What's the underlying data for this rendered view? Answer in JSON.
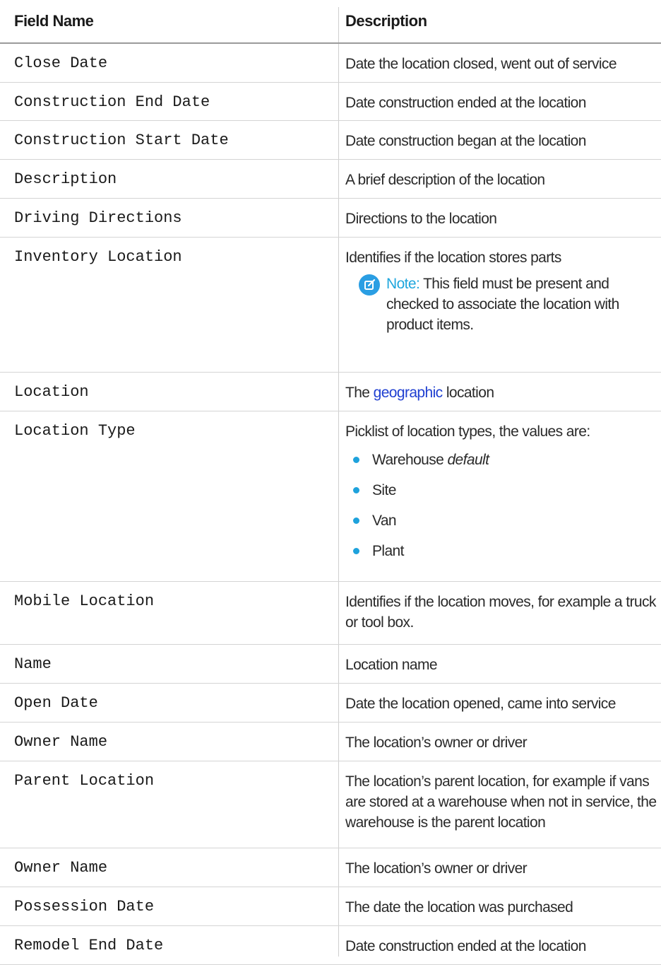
{
  "header": {
    "field_name": "Field Name",
    "description": "Description"
  },
  "rows": [
    {
      "field": "Close Date",
      "desc": "Date the location closed, went out of service"
    },
    {
      "field": "Construction End Date",
      "desc": "Date construction ended at the location"
    },
    {
      "field": "Construction Start Date",
      "desc": "Date construction began at the location"
    },
    {
      "field": "Description",
      "desc": "A brief description of the location"
    },
    {
      "field": "Driving Directions",
      "desc": "Directions to the location"
    },
    {
      "field": "Inventory Location",
      "desc": "Identifies if the location stores parts",
      "note_label": "Note:",
      "note_text": "This field must be present and checked to associate the location with product items."
    },
    {
      "field": "Location",
      "desc_before": "The",
      "link": "geographic",
      "desc_after": "location"
    },
    {
      "field": "Location Type",
      "desc": "Picklist of location types, the values are:",
      "items": [
        {
          "label": "Warehouse",
          "suffix": "default"
        },
        {
          "label": "Site"
        },
        {
          "label": "Van"
        },
        {
          "label": "Plant"
        }
      ]
    },
    {
      "field": "Mobile Location",
      "desc": "Identifies if the location moves, for example a truck or tool box."
    },
    {
      "field": "Name",
      "desc": "Location name"
    },
    {
      "field": "Open Date",
      "desc": "Date the location opened, came into service"
    },
    {
      "field": "Owner Name",
      "desc": "The location’s owner or driver"
    },
    {
      "field": "Parent Location",
      "desc": "The location’s parent location, for example if vans are stored at a warehouse when not in service, the warehouse is the parent location"
    },
    {
      "field": "Owner Name",
      "desc": "The location’s owner or driver"
    },
    {
      "field": "Possession Date",
      "desc": "The date the location was purchased"
    },
    {
      "field": "Remodel End Date",
      "desc": "Date construction ended at the location"
    }
  ]
}
